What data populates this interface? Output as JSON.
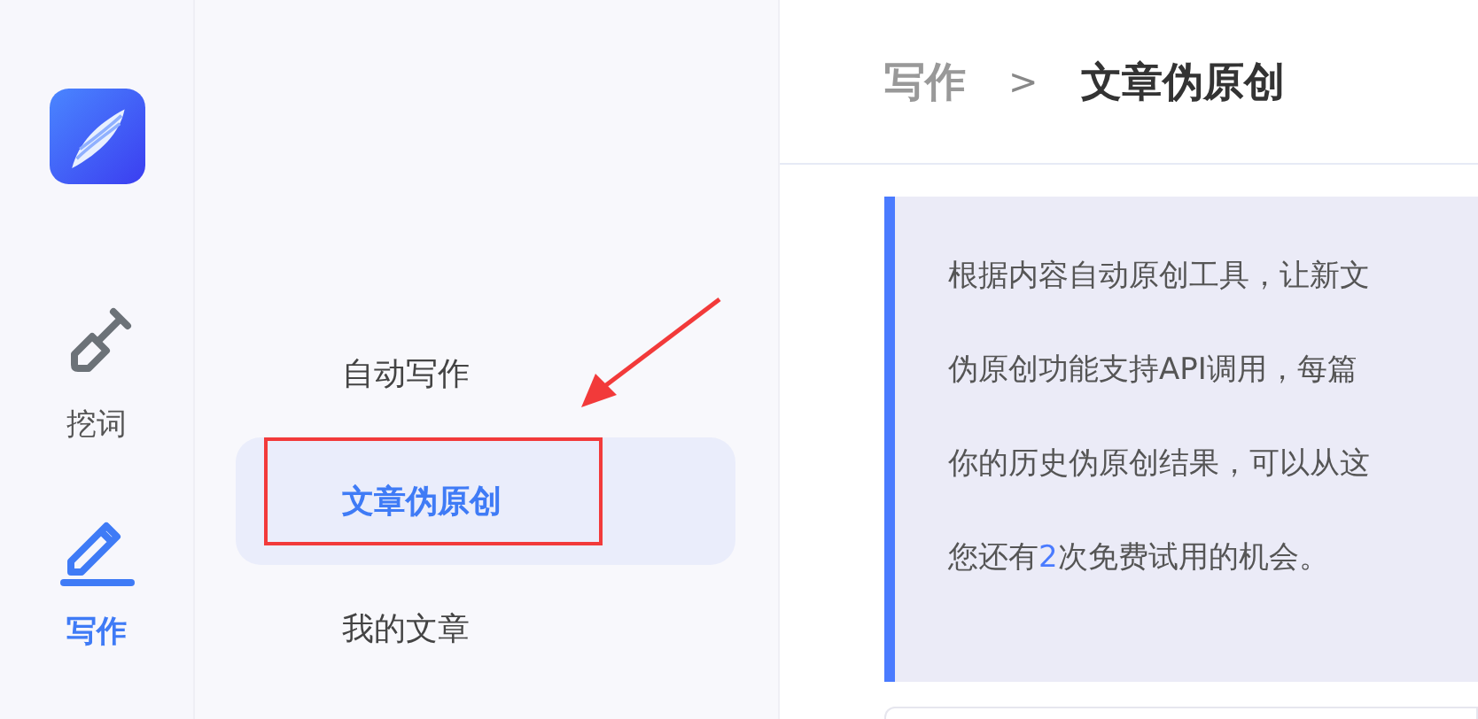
{
  "rail": {
    "items": [
      {
        "label": "挖词",
        "kind": "shovel",
        "selected": false
      },
      {
        "label": "写作",
        "kind": "pencil",
        "selected": true
      }
    ]
  },
  "submenu": {
    "items": [
      {
        "label": "自动写作",
        "selected": false
      },
      {
        "label": "文章伪原创",
        "selected": true
      },
      {
        "label": "我的文章",
        "selected": false
      }
    ]
  },
  "breadcrumb": {
    "parent": "写作",
    "separator": ">",
    "current": "文章伪原创"
  },
  "notice": {
    "lines": [
      [
        {
          "text": "根据内容自动原创工具，让新文",
          "highlight": false
        }
      ],
      [
        {
          "text": "伪原创功能支持API调用，每篇",
          "highlight": false
        }
      ],
      [
        {
          "text": "你的历史伪原创结果，可以从这",
          "highlight": false
        }
      ],
      [
        {
          "text": "您还有",
          "highlight": false
        },
        {
          "text": "2",
          "highlight": true
        },
        {
          "text": "次免费试用的机会。",
          "highlight": false
        }
      ]
    ]
  }
}
